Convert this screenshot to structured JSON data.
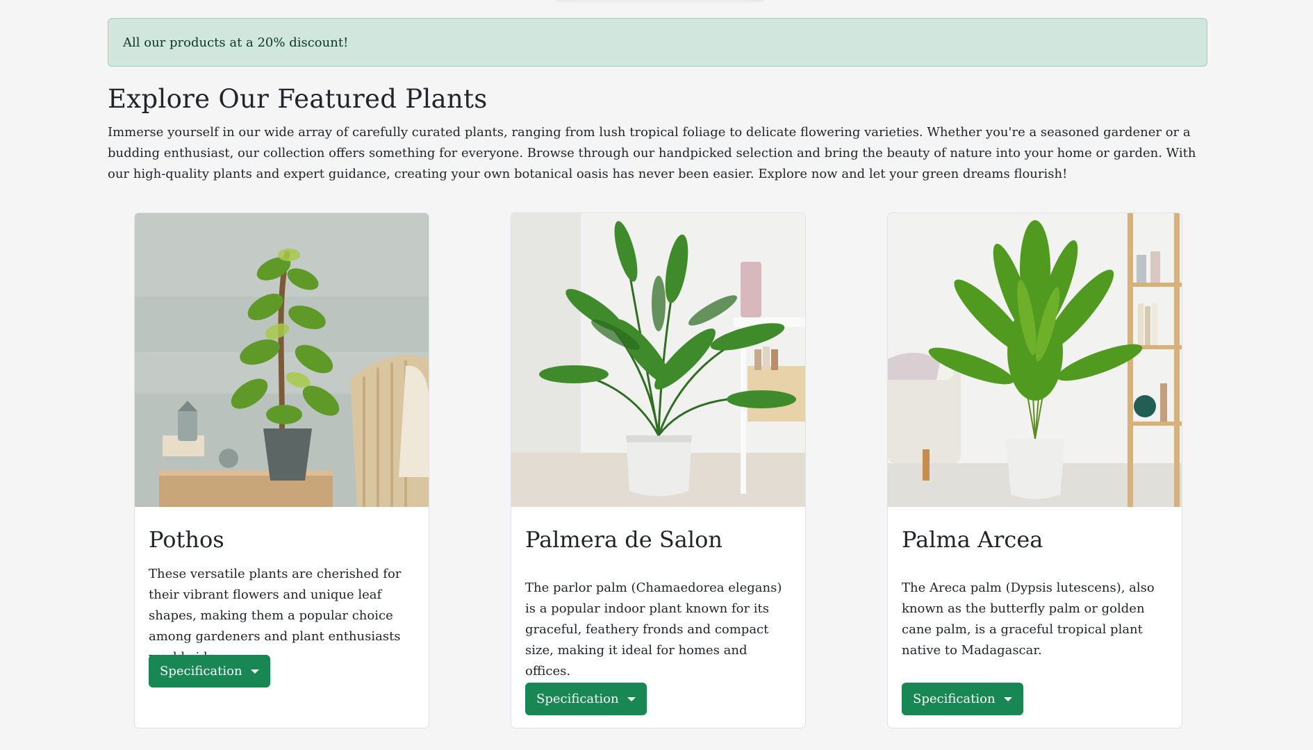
{
  "alert": {
    "text": "All our products at a 20% discount!"
  },
  "page": {
    "title": "Explore Our Featured Plants",
    "intro": "Immerse yourself in our wide array of carefully curated plants, ranging from lush tropical foliage to delicate flowering varieties. Whether you're a seasoned gardener or a budding enthusiast, our collection offers something for everyone. Browse through our handpicked selection and bring the beauty of nature into your home or garden. With our high-quality plants and expert guidance, creating your own botanical oasis has never been easier. Explore now and let your green dreams flourish!"
  },
  "cards": [
    {
      "title": "Pothos",
      "text": "These versatile plants are cherished for their vibrant flowers and unique leaf shapes, making them a popular choice among gardeners and plant enthusiasts worldwide.",
      "button": "Specification"
    },
    {
      "title": "Palmera de Salon",
      "text": "The parlor palm (Chamaedorea elegans) is a popular indoor plant known for its graceful, feathery fronds and compact size, making it ideal for homes and offices.",
      "button": "Specification"
    },
    {
      "title": "Palma Arcea",
      "text": "The Areca palm (Dypsis lutescens), also known as the butterfly palm or golden cane palm, is a graceful tropical plant native to Madagascar.",
      "button": "Specification"
    }
  ],
  "colors": {
    "alert_bg": "#d1e7dd",
    "alert_text": "#0a3622",
    "button_bg": "#198754",
    "page_bg": "#f5f5f5"
  },
  "icons": {
    "dropdown": "caret-down-icon"
  }
}
